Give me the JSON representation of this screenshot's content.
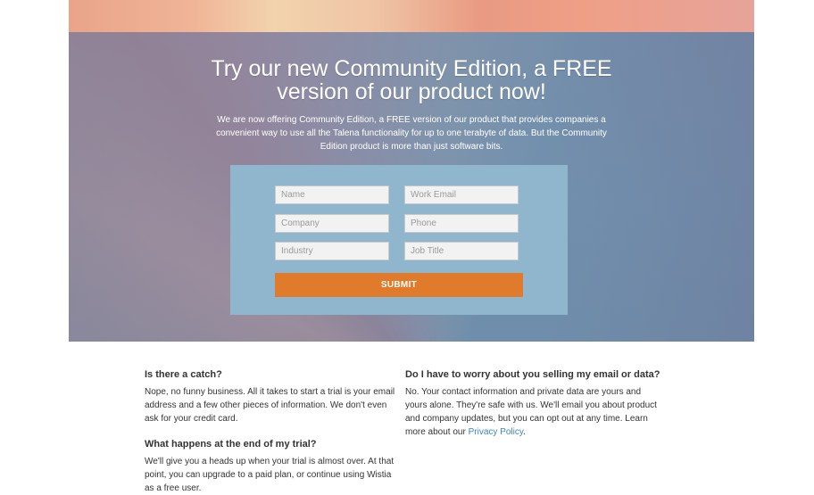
{
  "hero": {
    "title": "Try our new Community Edition, a FREE version of our product now!",
    "description": "We are now offering Community Edition, a FREE version of our product that provides companies a convenient way to use all the Talena functionality for up to one terabyte of data. But the Community Edition product is more than just software bits."
  },
  "form": {
    "name_placeholder": "Name",
    "work_email_placeholder": "Work Email",
    "company_placeholder": "Company",
    "phone_placeholder": "Phone",
    "industry_placeholder": "Industry",
    "job_title_placeholder": "Job Title",
    "submit_label": "SUBMIT"
  },
  "faq": {
    "catch": {
      "question": "Is there a catch?",
      "answer": "Nope, no funny business. All it takes to start a trial is your email address and a few other pieces of information. We don't even ask for your credit card."
    },
    "end_of_trial": {
      "question": "What happens at the end of my trial?",
      "answer": "We'll give you a heads up when your trial is almost over. At that point, you can upgrade to a paid plan, or continue using Wistia as a free user."
    },
    "selling_data": {
      "question": "Do I have to worry about you selling my email or data?",
      "answer_prefix": "No. Your contact information and private data are yours and yours alone. They're safe with us. We'll email you about product and company updates, but you can opt out at any time. Learn more about our ",
      "link_text": "Privacy Policy",
      "answer_suffix": "."
    }
  },
  "colors": {
    "accent_submit": "#e07b2c",
    "form_box": "#8fb6cd",
    "link": "#3a86c2"
  }
}
